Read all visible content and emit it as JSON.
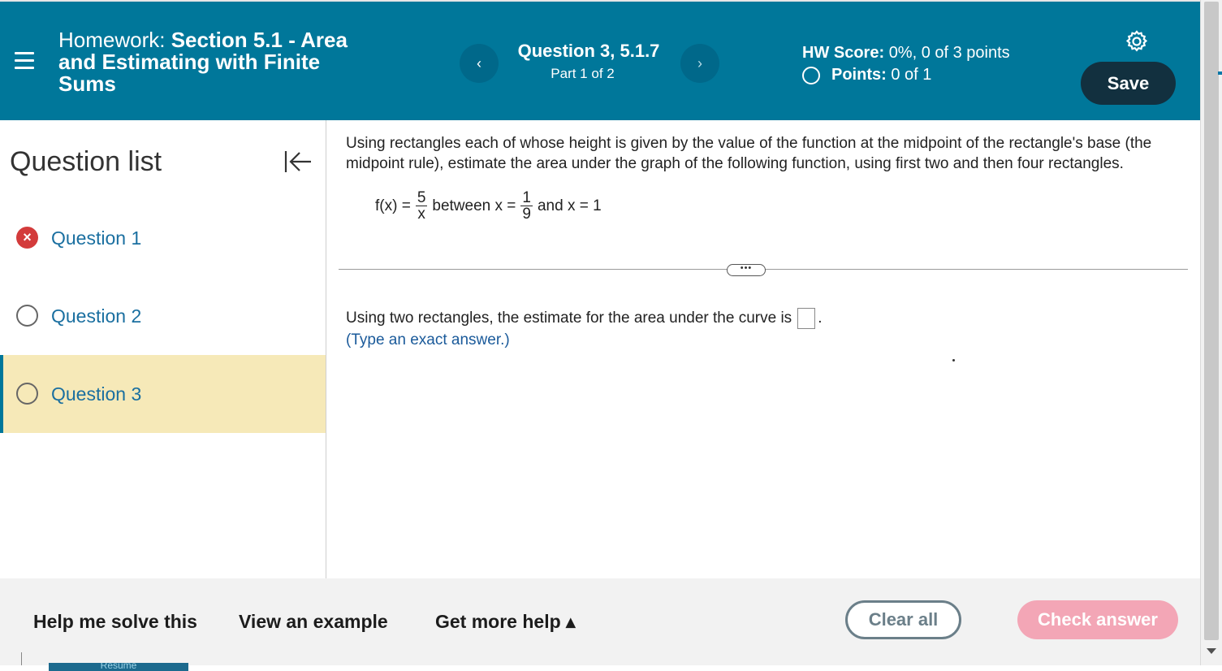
{
  "header": {
    "title_prefix": "Homework:",
    "title_name": "Section 5.1 - Area and Estimating with Finite Sums",
    "question_title": "Question 3, 5.1.7",
    "question_part": "Part 1 of 2",
    "prev_glyph": "‹",
    "next_glyph": "›",
    "hw_score_label": "HW Score:",
    "hw_score_value": "0%, 0 of 3 points",
    "points_label": "Points:",
    "points_value": "0 of 1",
    "save_label": "Save",
    "bg_color": "#00779a"
  },
  "sidebar": {
    "title": "Question list",
    "items": [
      {
        "label": "Question 1",
        "status": "incorrect",
        "status_glyph": "×"
      },
      {
        "label": "Question 2",
        "status": "unanswered"
      },
      {
        "label": "Question 3",
        "status": "current"
      }
    ]
  },
  "question": {
    "prompt": "Using rectangles each of whose height is given by the value of the function at the midpoint of the rectangle's base (the midpoint rule), estimate the area under the graph of the following function, using first two and then four rectangles.",
    "fx": "f(x) =",
    "fx_num": "5",
    "fx_den": "x",
    "between": "between x =",
    "lower_num": "1",
    "lower_den": "9",
    "upper": "and x = 1",
    "more_glyph": "•••",
    "answer_prefix": "Using two rectangles, the estimate for the area under the curve is",
    "answer_suffix": ".",
    "answer_value": "",
    "hint": "(Type an exact answer.)"
  },
  "footer": {
    "help": "Help me solve this",
    "example": "View an example",
    "more_help": "Get more help ▴",
    "clear": "Clear all",
    "check": "Check answer",
    "resume": "Resume"
  },
  "colors": {
    "header": "#00779a",
    "save_button": "#12303f",
    "active_question_bg": "#f6e9b8",
    "check_button": "#f3a6b6",
    "incorrect": "#d33b3b"
  }
}
